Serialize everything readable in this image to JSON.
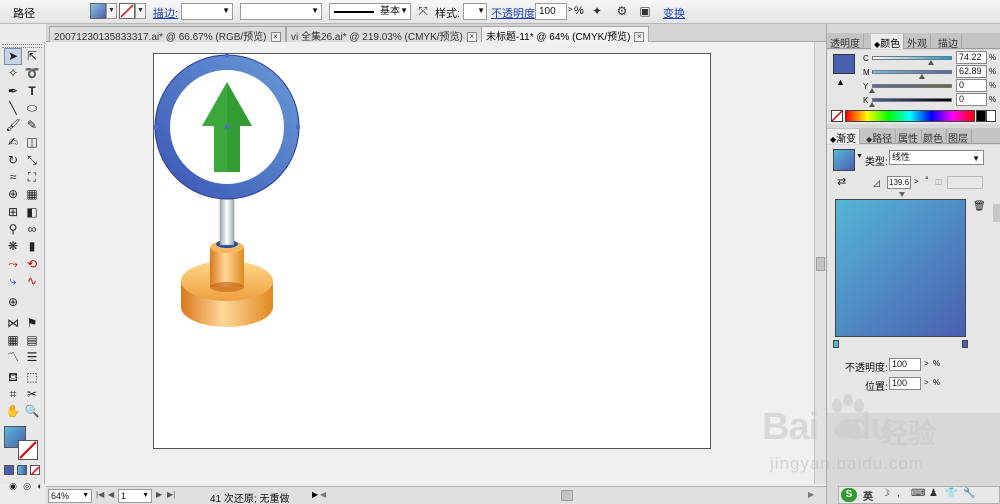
{
  "control_bar": {
    "object_type": "路径",
    "fill_color": "#6a8fd0",
    "stroke_link": "描边:",
    "stroke_weight": "",
    "stroke_profile": "",
    "brush_label": "基本",
    "style_label": "样式:",
    "opacity_link": "不透明度:",
    "opacity_value": "100",
    "opacity_unit": "%",
    "transform_link": "变换"
  },
  "doc_tabs": [
    {
      "label": "20071230135833317.ai* @ 66.67% (RGB/预览)"
    },
    {
      "label": "vi 全集26.ai* @ 219.03% (CMYK/预览)"
    },
    {
      "label": "未标题-11* @ 64% (CMYK/预览)"
    }
  ],
  "panels": {
    "color_tabs": [
      "透明度",
      "颜色",
      "外观",
      "描边"
    ],
    "cmyk": [
      {
        "channel": "C",
        "value": "74.22",
        "fraction": 0.742
      },
      {
        "channel": "M",
        "value": "62.89",
        "fraction": 0.629
      },
      {
        "channel": "Y",
        "value": "0",
        "fraction": 0
      },
      {
        "channel": "K",
        "value": "0",
        "fraction": 0
      }
    ],
    "gradient_tabs": [
      "渐变",
      "路径",
      "属性",
      "颜色",
      "图层"
    ],
    "type_label": "类型:",
    "type_value": "线性",
    "angle_value": "139.6",
    "angle_unit": "°",
    "gradient_start": "#55b6d6",
    "gradient_end": "#4a5fb0",
    "opacity_label": "不透明度:",
    "opacity_value": "100",
    "position_label": "位置:",
    "position_value": "100",
    "percent": "%"
  },
  "status_bar": {
    "zoom": "64%",
    "page": "1",
    "info": "41 次还原; 无重做"
  },
  "watermark": {
    "brand": "Bai",
    "brand_tail": "du",
    "product": "经验",
    "url": "jingyan.baidu.com"
  },
  "tray": {
    "ime": "英"
  }
}
